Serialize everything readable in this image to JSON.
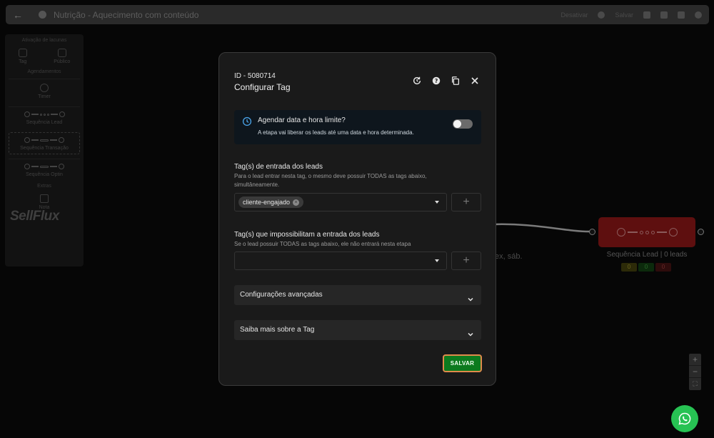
{
  "topbar": {
    "title": "Nutrição - Aquecimento com conteúdo",
    "disable_label": "Desativar",
    "save_label": "Salvar"
  },
  "sidebar": {
    "section_actions": "Ativação de lacunas",
    "items_actions": [
      {
        "label": "Tag",
        "icon": "tag-icon"
      },
      {
        "label": "Público",
        "icon": "users-icon"
      }
    ],
    "section_schedule": "Agendamentos",
    "timer_label": "Timer",
    "seq_lead_label": "Sequência Lead",
    "seq_transacao_label": "Sequência Transação",
    "seq_optin_label": "Sequência Optin",
    "section_extra": "Extras",
    "note_label": "Nota",
    "logo": "SellFlux"
  },
  "canvas": {
    "side_text": "ex, sáb.",
    "node_label": "Sequência Lead | 0 leads",
    "counters": [
      "0",
      "0",
      "0"
    ],
    "zoom": [
      "+",
      "−",
      "⛶"
    ]
  },
  "modal": {
    "id": "ID - 5080714",
    "title": "Configurar Tag",
    "schedule": {
      "question": "Agendar data e hora limite?",
      "description": "A etapa vai liberar os leads até uma data e hora determinada."
    },
    "entry": {
      "heading": "Tag(s) de entrada dos leads",
      "description": "Para o lead entrar nesta tag, o mesmo deve possuir TODAS as tags abaixo, simultâneamente.",
      "chip": "cliente-engajado",
      "add": "+"
    },
    "block": {
      "heading": "Tag(s) que impossibilitam a entrada dos leads",
      "description": "Se o lead possuir TODAS as tags abaixo, ele não entrará nesta etapa",
      "add": "+"
    },
    "advanced": "Configurações avançadas",
    "learn_more": "Saiba mais sobre a Tag",
    "save": "SALVAR"
  },
  "colors": {
    "save_bg": "#0c7a1e",
    "save_border": "#e08a4b",
    "node_bg": "#5e0f0f",
    "whatsapp": "#27c253"
  }
}
